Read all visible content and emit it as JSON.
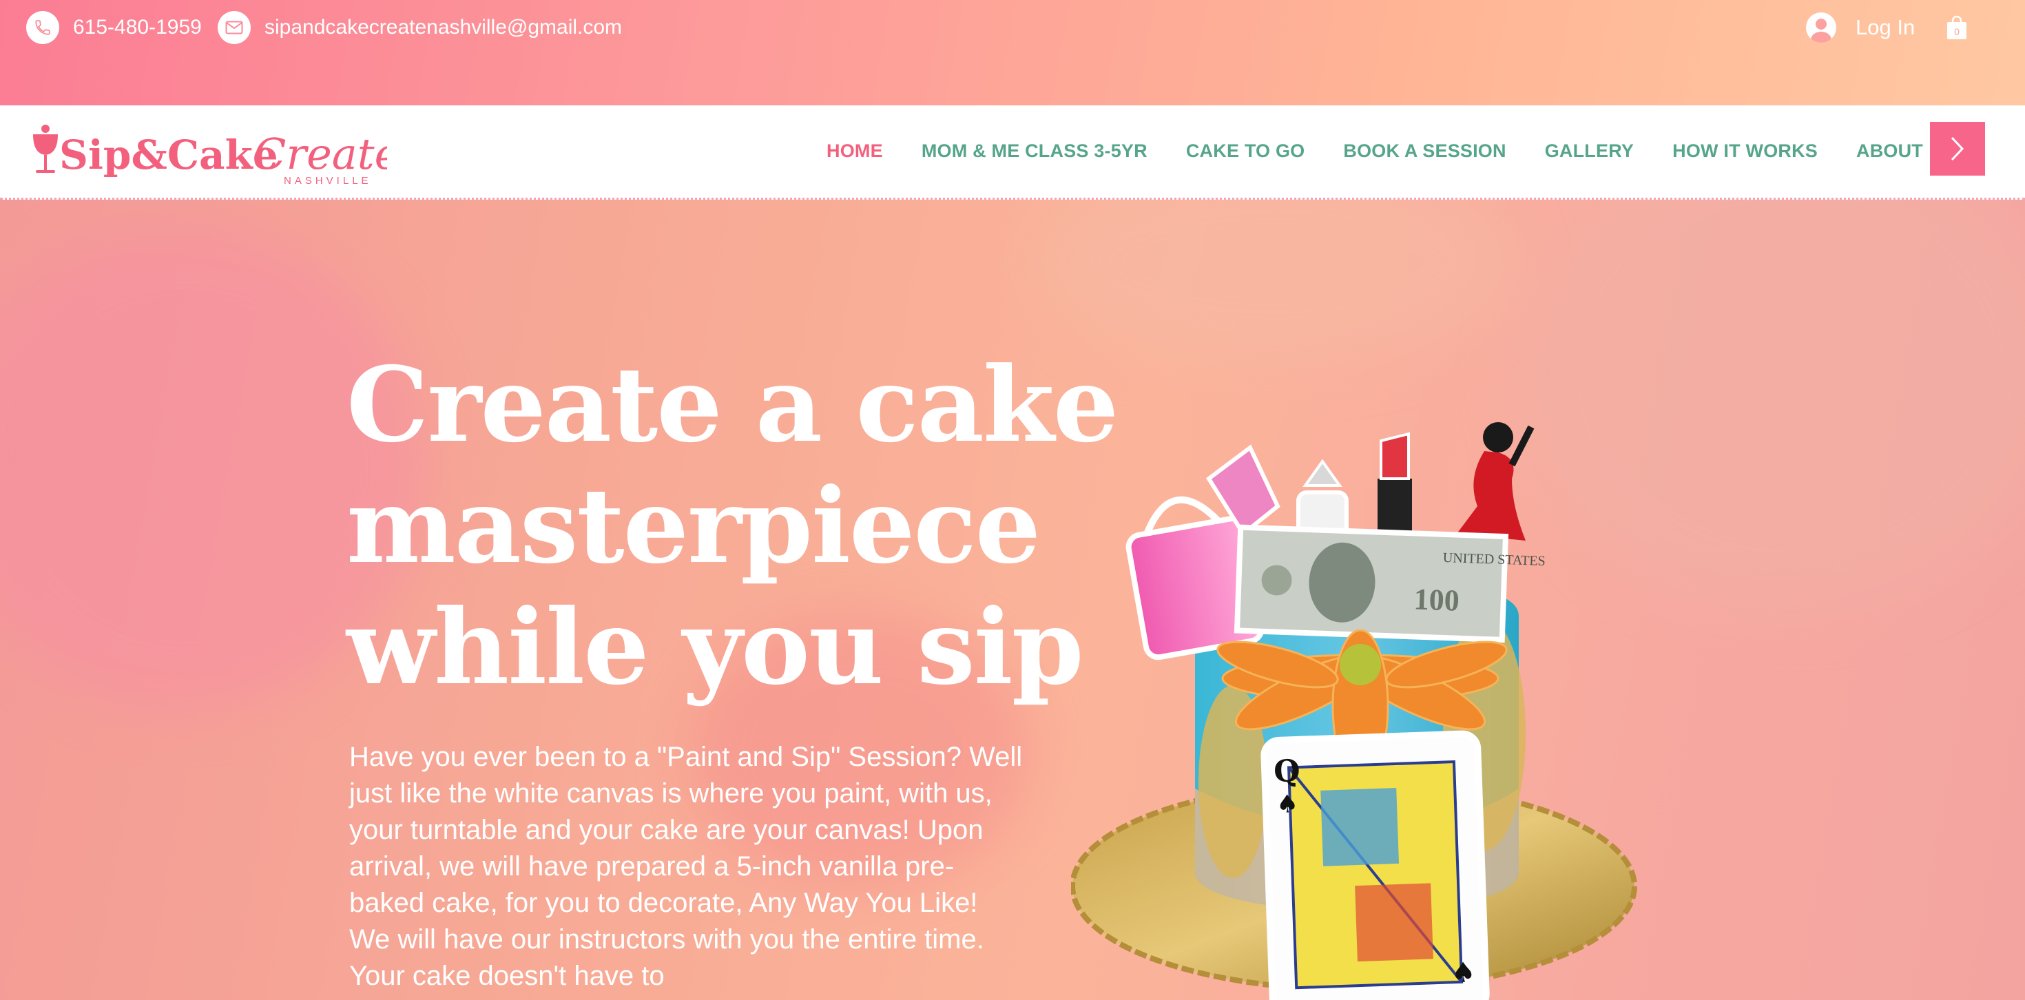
{
  "contact": {
    "phone": "615-480-1959",
    "email": "sipandcakecreatenashville@gmail.com"
  },
  "account": {
    "login_label": "Log In",
    "cart_count": "0"
  },
  "brand": {
    "name_part1": "Sip&Cake",
    "name_part2": "Create",
    "city": "NASHVILLE"
  },
  "nav": {
    "items": [
      {
        "label": "HOME"
      },
      {
        "label": "MOM & ME CLASS 3-5YR"
      },
      {
        "label": "CAKE TO GO"
      },
      {
        "label": "BOOK A SESSION"
      },
      {
        "label": "GALLERY"
      },
      {
        "label": "HOW IT WORKS"
      },
      {
        "label": "ABOUT"
      }
    ],
    "active": "HOME"
  },
  "hero": {
    "headline_lines": [
      "Create a cake",
      "masterpiece",
      "while you sip"
    ],
    "body": "Have you ever been to a \"Paint and Sip\" Session? Well just like the white canvas is where you paint, with us, your turntable and your cake are your canvas! Upon arrival, we will have prepared a 5-inch vanilla pre-baked cake, for you to decorate, Any Way You Like! We will have our instructors with you the entire time. Your cake doesn't have to",
    "cake_card_rank": "Q"
  },
  "colors": {
    "brand_pink": "#f2607d",
    "nav_green": "#56a58b",
    "button_pink": "#f7668a"
  }
}
